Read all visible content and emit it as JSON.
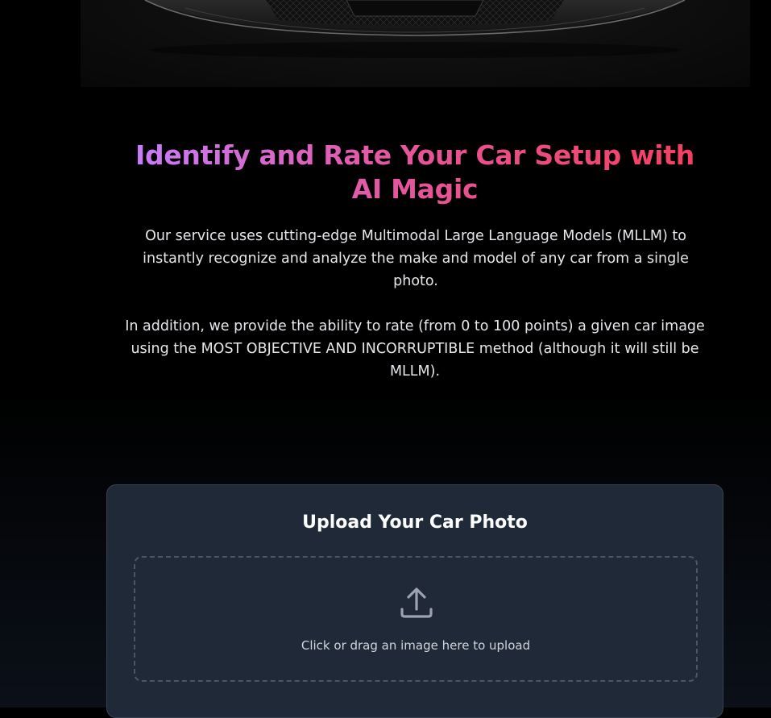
{
  "hero": {
    "image_alt": "Black sports car front"
  },
  "headline": "Identify and Rate Your Car Setup with AI Magic",
  "description": {
    "paragraph_1": "Our service uses cutting-edge Multimodal Large Language Models (MLLM) to instantly recognize and analyze the make and model of any car from a single photo.",
    "paragraph_2": "In addition, we provide the ability to rate (from 0 to 100 points) a given car image using the MOST OBJECTIVE AND INCORRUPTIBLE method (although it will still be MLLM)."
  },
  "upload": {
    "title": "Upload Your Car Photo",
    "dropzone_label": "Click or drag an image here to upload",
    "icon": "upload-icon"
  },
  "colors": {
    "headline_gradient_start": "#c77dff",
    "headline_gradient_mid": "#e457a0",
    "headline_gradient_end": "#f43f5e",
    "card_background": "#1f2937",
    "page_background": "#000000"
  }
}
